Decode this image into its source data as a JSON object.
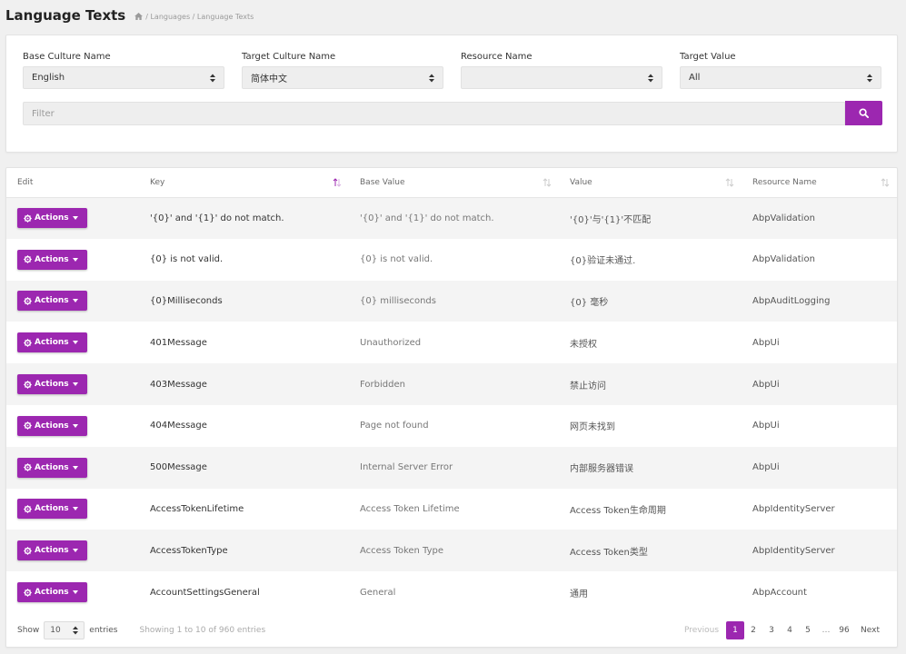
{
  "header": {
    "title": "Language Texts",
    "breadcrumb": "/ Languages / Language Texts"
  },
  "filters": {
    "base_culture": {
      "label": "Base Culture Name",
      "value": "English"
    },
    "target_culture": {
      "label": "Target Culture Name",
      "value": "简体中文"
    },
    "resource_name": {
      "label": "Resource Name",
      "value": ""
    },
    "target_value": {
      "label": "Target Value",
      "value": "All"
    },
    "filter_placeholder": "Filter"
  },
  "table": {
    "columns": [
      "Edit",
      "Key",
      "Base Value",
      "Value",
      "Resource Name"
    ],
    "action_label": "Actions",
    "rows": [
      {
        "key": "'{0}' and '{1}' do not match.",
        "base": "'{0}' and '{1}' do not match.",
        "value": "'{0}'与'{1}'不匹配",
        "resource": "AbpValidation"
      },
      {
        "key": "{0} is not valid.",
        "base": "{0} is not valid.",
        "value": "{0}验证未通过.",
        "resource": "AbpValidation"
      },
      {
        "key": "{0}Milliseconds",
        "base": "{0} milliseconds",
        "value": "{0} 毫秒",
        "resource": "AbpAuditLogging"
      },
      {
        "key": "401Message",
        "base": "Unauthorized",
        "value": "未授权",
        "resource": "AbpUi"
      },
      {
        "key": "403Message",
        "base": "Forbidden",
        "value": "禁止访问",
        "resource": "AbpUi"
      },
      {
        "key": "404Message",
        "base": "Page not found",
        "value": "网页未找到",
        "resource": "AbpUi"
      },
      {
        "key": "500Message",
        "base": "Internal Server Error",
        "value": "内部服务器错误",
        "resource": "AbpUi"
      },
      {
        "key": "AccessTokenLifetime",
        "base": "Access Token Lifetime",
        "value": "Access Token生命周期",
        "resource": "AbpIdentityServer"
      },
      {
        "key": "AccessTokenType",
        "base": "Access Token Type",
        "value": "Access Token类型",
        "resource": "AbpIdentityServer"
      },
      {
        "key": "AccountSettingsGeneral",
        "base": "General",
        "value": "通用",
        "resource": "AbpAccount"
      }
    ]
  },
  "footer": {
    "show_label": "Show",
    "page_size": "10",
    "entries_label": "entries",
    "info": "Showing 1 to 10 of 960 entries",
    "pagination": {
      "previous": "Previous",
      "pages": [
        "1",
        "2",
        "3",
        "4",
        "5"
      ],
      "ellipsis": "…",
      "last": "96",
      "next": "Next"
    }
  },
  "colors": {
    "accent": "#9c27b0",
    "background": "#f0f0f0"
  },
  "icons": [
    "home-icon",
    "search-icon",
    "cog-icon",
    "caret-icon",
    "sort-icon"
  ]
}
